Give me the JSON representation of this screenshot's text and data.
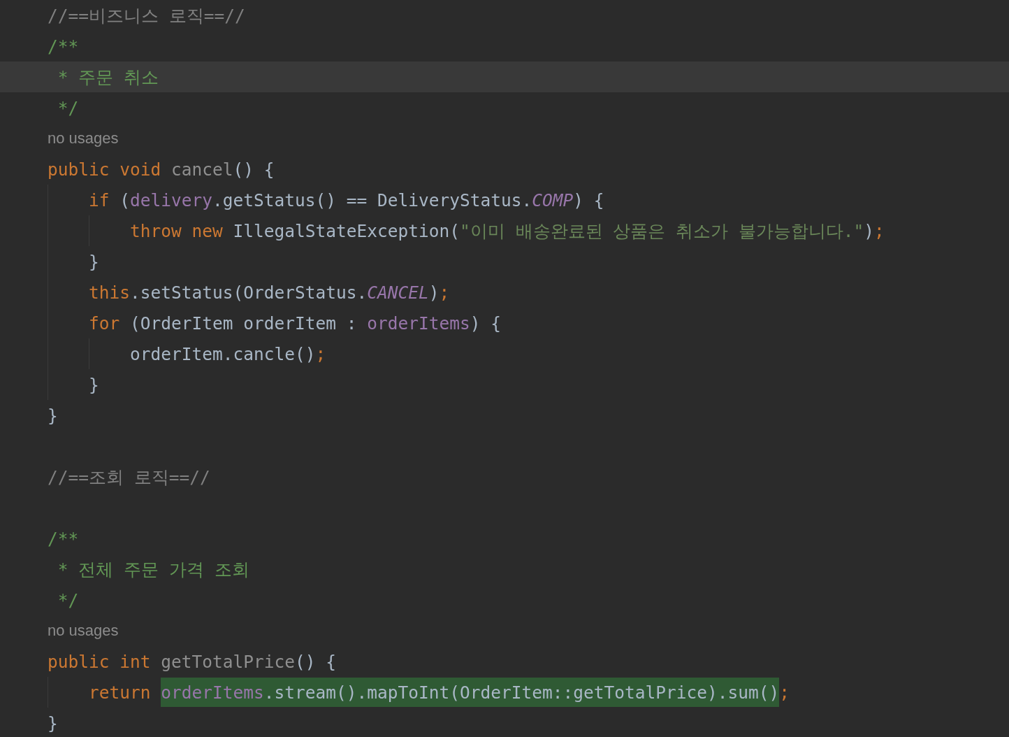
{
  "editor": {
    "lines": [
      {
        "current": false,
        "tokens": [
          {
            "kind": "comment",
            "text": "//==비즈니스 로직==//"
          }
        ]
      },
      {
        "current": false,
        "tokens": [
          {
            "kind": "doc",
            "text": "/**"
          }
        ]
      },
      {
        "current": true,
        "tokens": [
          {
            "kind": "doc",
            "text": " * 주문 취소"
          }
        ]
      },
      {
        "current": false,
        "tokens": [
          {
            "kind": "doc",
            "text": " */"
          }
        ]
      },
      {
        "current": false,
        "tokens": [
          {
            "kind": "hint",
            "text": "no usages"
          }
        ]
      },
      {
        "current": false,
        "tokens": [
          {
            "kind": "keyword",
            "text": "public void "
          },
          {
            "kind": "unused",
            "text": "cancel"
          },
          {
            "kind": "plain",
            "text": "() {"
          }
        ]
      },
      {
        "current": false,
        "tokens": [
          {
            "kind": "keyword",
            "text": "    if "
          },
          {
            "kind": "plain",
            "text": "("
          },
          {
            "kind": "field",
            "text": "delivery"
          },
          {
            "kind": "plain",
            "text": ".getStatus() == DeliveryStatus."
          },
          {
            "kind": "constant",
            "text": "COMP"
          },
          {
            "kind": "plain",
            "text": ") {"
          }
        ]
      },
      {
        "current": false,
        "tokens": [
          {
            "kind": "keyword",
            "text": "        throw new "
          },
          {
            "kind": "plain",
            "text": "IllegalStateException("
          },
          {
            "kind": "string",
            "text": "\"이미 배송완료된 상품은 취소가 불가능합니다.\""
          },
          {
            "kind": "plain",
            "text": ")"
          },
          {
            "kind": "keyword",
            "text": ";"
          }
        ]
      },
      {
        "current": false,
        "tokens": [
          {
            "kind": "plain",
            "text": "    }"
          }
        ]
      },
      {
        "current": false,
        "tokens": [
          {
            "kind": "keyword",
            "text": "    this"
          },
          {
            "kind": "plain",
            "text": ".setStatus(OrderStatus."
          },
          {
            "kind": "constant",
            "text": "CANCEL"
          },
          {
            "kind": "plain",
            "text": ")"
          },
          {
            "kind": "keyword",
            "text": ";"
          }
        ]
      },
      {
        "current": false,
        "tokens": [
          {
            "kind": "keyword",
            "text": "    for "
          },
          {
            "kind": "plain",
            "text": "(OrderItem orderItem : "
          },
          {
            "kind": "field",
            "text": "orderItems"
          },
          {
            "kind": "plain",
            "text": ") {"
          }
        ]
      },
      {
        "current": false,
        "tokens": [
          {
            "kind": "plain",
            "text": "        orderItem.cancle()"
          },
          {
            "kind": "keyword",
            "text": ";"
          }
        ]
      },
      {
        "current": false,
        "tokens": [
          {
            "kind": "plain",
            "text": "    }"
          }
        ]
      },
      {
        "current": false,
        "tokens": [
          {
            "kind": "plain",
            "text": "}"
          }
        ]
      },
      {
        "current": false
      },
      {
        "current": false,
        "tokens": [
          {
            "kind": "comment",
            "text": "//==조회 로직==//"
          }
        ]
      },
      {
        "current": false
      },
      {
        "current": false,
        "tokens": [
          {
            "kind": "doc",
            "text": "/**"
          }
        ]
      },
      {
        "current": false,
        "tokens": [
          {
            "kind": "doc",
            "text": " * 전체 주문 가격 조회"
          }
        ]
      },
      {
        "current": false,
        "tokens": [
          {
            "kind": "doc",
            "text": " */"
          }
        ]
      },
      {
        "current": false,
        "tokens": [
          {
            "kind": "hint",
            "text": "no usages"
          }
        ]
      },
      {
        "current": false,
        "tokens": [
          {
            "kind": "keyword",
            "text": "public int "
          },
          {
            "kind": "unused",
            "text": "getTotalPrice"
          },
          {
            "kind": "plain",
            "text": "() {"
          }
        ]
      },
      {
        "current": false,
        "tokens": [
          {
            "kind": "keyword",
            "text": "    return "
          },
          {
            "kind": "match",
            "tokens": [
              {
                "kind": "field",
                "text": "orderItems"
              },
              {
                "kind": "plain",
                "text": ".stream().mapToInt(OrderItem::getTotalPrice).sum()"
              }
            ]
          },
          {
            "kind": "keyword",
            "text": ";"
          }
        ]
      },
      {
        "current": false,
        "tokens": [
          {
            "kind": "plain",
            "text": "}"
          }
        ]
      }
    ]
  }
}
